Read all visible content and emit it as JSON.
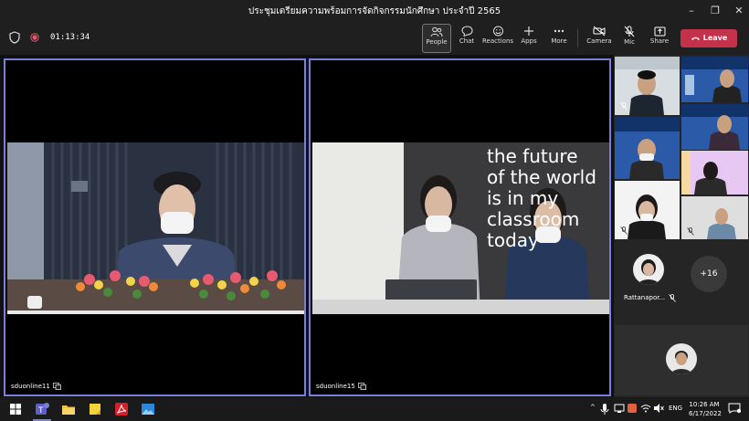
{
  "window": {
    "title": "ประชุมเตรียมความพร้อมการจัดกิจกรรมนักศึกษา ประจำปี 2565",
    "minimize": "–",
    "maximize": "❐",
    "close": "✕"
  },
  "toolbar": {
    "timer": "01:13:34",
    "people": "People",
    "chat": "Chat",
    "reactions": "Reactions",
    "apps": "Apps",
    "more": "More",
    "camera": "Camera",
    "mic": "Mic",
    "share": "Share",
    "leave": "Leave"
  },
  "stage": {
    "tiles": [
      {
        "name": "sduonline11"
      },
      {
        "name": "sduonline15"
      }
    ],
    "slogan": [
      "the future",
      "of the world",
      "is in my",
      "classroom",
      "today"
    ]
  },
  "sidebar": {
    "named_participant": "Rattanapor...",
    "overflow_count": "+16"
  },
  "taskbar": {
    "language": "ENG",
    "time": "10:26 AM",
    "date": "6/17/2022",
    "chevron": "^"
  }
}
